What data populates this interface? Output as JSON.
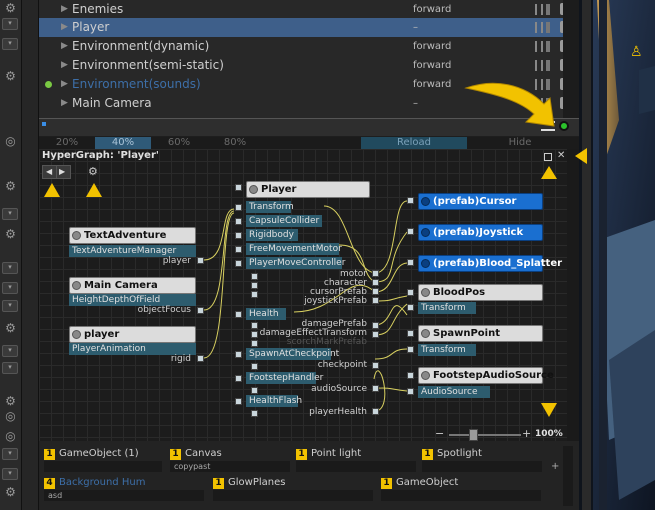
{
  "hierarchy": {
    "rows": [
      {
        "name": "Enemies",
        "mode": "forward",
        "selected": false,
        "dim": false,
        "dot": false
      },
      {
        "name": "Player",
        "mode": "–",
        "selected": true,
        "dim": false,
        "dot": false
      },
      {
        "name": "Environment(dynamic)",
        "mode": "forward",
        "selected": false,
        "dim": false,
        "dot": false
      },
      {
        "name": "Environment(semi-static)",
        "mode": "forward",
        "selected": false,
        "dim": false,
        "dot": false
      },
      {
        "name": "Environment(sounds)",
        "mode": "forward",
        "selected": false,
        "dim": true,
        "dot": true
      },
      {
        "name": "Main Camera",
        "mode": "–",
        "selected": false,
        "dim": false,
        "dot": false
      }
    ]
  },
  "zoom_tabs": [
    "20%",
    "40%",
    "60%",
    "80%",
    "Reload",
    "Hide"
  ],
  "graph": {
    "title": "HyperGraph: 'Player'",
    "zoom_percent": "100%",
    "zoom_minus": "−",
    "zoom_plus": "+",
    "nodes": {
      "text_adventure": {
        "title": "TextAdventure",
        "comp": "TextAdventureManager",
        "out": "player"
      },
      "main_camera": {
        "title": "Main Camera",
        "comp": "HeightDepthOfField",
        "out": "objectFocus"
      },
      "player_left": {
        "title": "player",
        "comp": "PlayerAnimation",
        "out": "rigid"
      },
      "player": {
        "title": "Player",
        "components": [
          "Transform",
          "CapsuleCollider",
          "Rigidbody",
          "FreeMovementMotor",
          "PlayerMoveController",
          "Health",
          "SpawnAtCheckpoint",
          "FootstepHandler",
          "HealthFlash"
        ],
        "fields": [
          "motor",
          "character",
          "cursorPrefab",
          "joystickPrefab",
          "damagePrefab",
          "damageEffectTransform",
          "scorchMarkPrefab",
          "checkpoint",
          "audioSource",
          "playerHealth"
        ]
      },
      "cursor": {
        "title": "(prefab)Cursor"
      },
      "joystick": {
        "title": "(prefab)Joystick"
      },
      "blood": {
        "title": "(prefab)Blood_Splatter"
      },
      "bloodpos": {
        "title": "BloodPos",
        "comp": "Transform"
      },
      "spawnpoint": {
        "title": "SpawnPoint",
        "comp": "Transform"
      },
      "footstep": {
        "title": "FootstepAudioSource",
        "comp": "AudioSource"
      }
    }
  },
  "bottom": {
    "row1": [
      {
        "num": "1",
        "label": "GameObject (1)",
        "sub": ""
      },
      {
        "num": "1",
        "label": "Canvas",
        "sub": "copypast"
      },
      {
        "num": "1",
        "label": "Point light",
        "sub": ""
      },
      {
        "num": "1",
        "label": "Spotlight",
        "sub": ""
      }
    ],
    "row2": [
      {
        "num": "4",
        "label": "Background Hum",
        "sub": "asd"
      },
      {
        "num": "1",
        "label": "GlowPlanes",
        "sub": ""
      },
      {
        "num": "1",
        "label": "GameObject",
        "sub": ""
      }
    ]
  },
  "colors": {
    "accent_yellow": "#f2c200",
    "selection": "#3e5f8a",
    "prefab_node": "#1a6fd0",
    "component": "#2d5c6e"
  }
}
